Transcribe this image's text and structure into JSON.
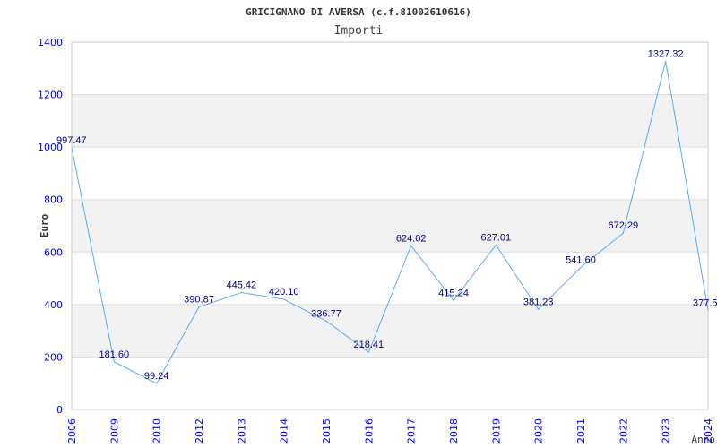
{
  "chart_data": {
    "type": "line",
    "title": "GRICIGNANO DI AVERSA (c.f.81002610616)",
    "subtitle": "Importi",
    "xlabel": "Anno",
    "ylabel": "Euro",
    "categories": [
      "2006",
      "2009",
      "2010",
      "2012",
      "2013",
      "2014",
      "2015",
      "2016",
      "2017",
      "2018",
      "2019",
      "2020",
      "2021",
      "2022",
      "2023",
      "2024"
    ],
    "values": [
      997.47,
      181.6,
      99.24,
      390.87,
      445.42,
      420.1,
      336.77,
      218.41,
      624.02,
      415.24,
      627.01,
      381.23,
      541.6,
      672.29,
      1327.32,
      377.5
    ],
    "data_labels": [
      "997.47",
      "181.60",
      "99.24",
      "390.87",
      "445.42",
      "420.10",
      "336.77",
      "218.41",
      "624.02",
      "415.24",
      "627.01",
      "381.23",
      "541.60",
      "672.29",
      "1327.32",
      "377.5"
    ],
    "ylim": [
      0,
      1400
    ],
    "yticks": [
      0,
      200,
      400,
      600,
      800,
      1000,
      1200,
      1400
    ],
    "grid": true,
    "legend": "none",
    "colors": {
      "line": "#5aa9f5",
      "tick": "#0000ff",
      "label": "#000080",
      "band": "#f2f2f2"
    }
  }
}
